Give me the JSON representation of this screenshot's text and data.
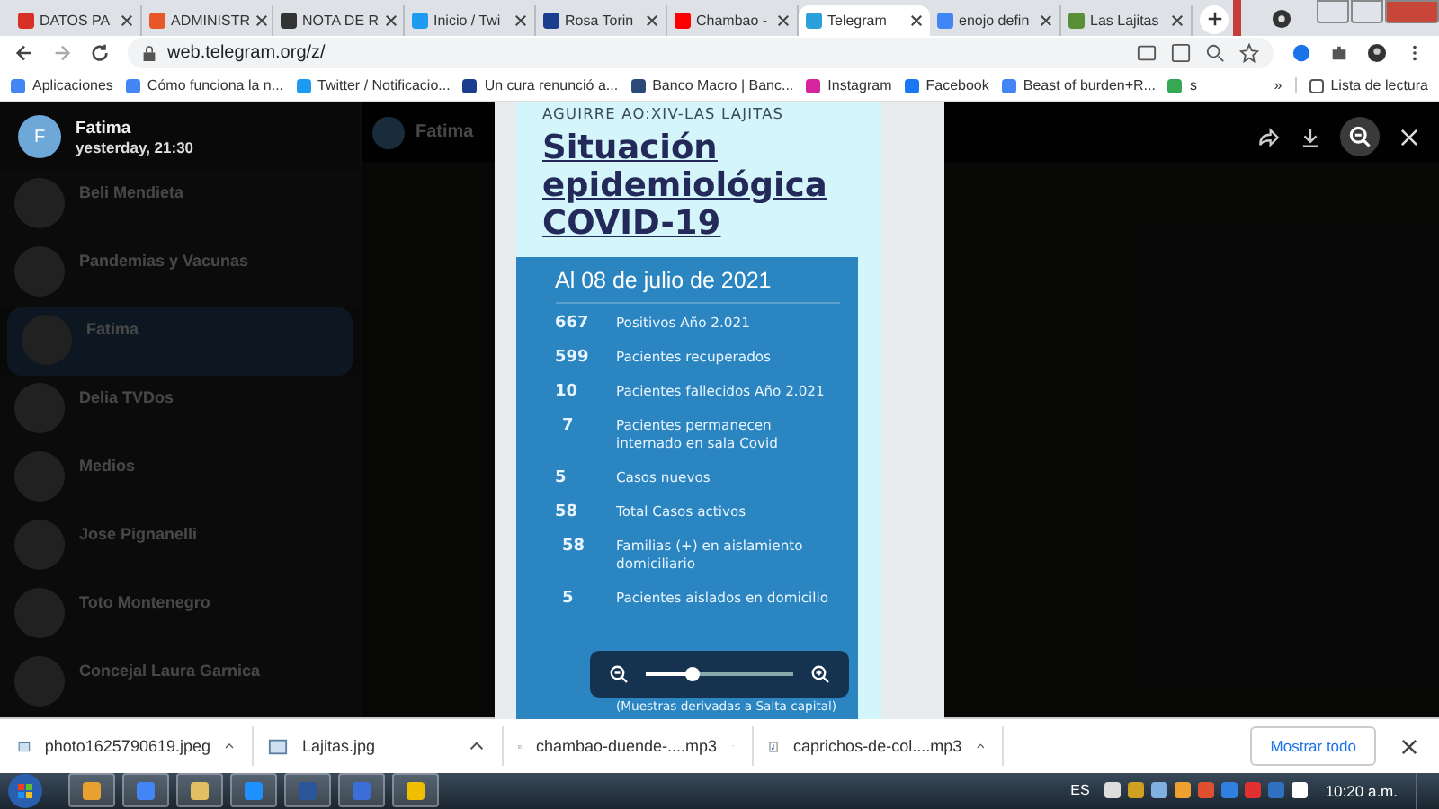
{
  "browser": {
    "tabs": [
      {
        "title": "DATOS PA",
        "selected": false,
        "color": "#d93025"
      },
      {
        "title": "ADMINISTR",
        "selected": false,
        "color": "#e8572a"
      },
      {
        "title": "NOTA DE R",
        "selected": false,
        "color": "#333333"
      },
      {
        "title": "Inicio / Twi",
        "selected": false,
        "color": "#1d9bf0"
      },
      {
        "title": "Rosa Torin",
        "selected": false,
        "color": "#1a3d8f"
      },
      {
        "title": "Chambao -",
        "selected": false,
        "color": "#ff0000"
      },
      {
        "title": "Telegram",
        "selected": true,
        "color": "#2aa1da"
      },
      {
        "title": "enojo defin",
        "selected": false,
        "color": "#4285f4"
      },
      {
        "title": "Las Lajitas",
        "selected": false,
        "color": "#5a8f3a"
      }
    ],
    "address": "web.telegram.org/z/",
    "bookmarks": [
      {
        "label": "Aplicaciones",
        "color": "#4285f4"
      },
      {
        "label": "Cómo funciona la n...",
        "color": "#4285f4"
      },
      {
        "label": "Twitter / Notificacio...",
        "color": "#1d9bf0"
      },
      {
        "label": "Un cura renunció a...",
        "color": "#1a3d8f"
      },
      {
        "label": "Banco Macro | Banc...",
        "color": "#2b4a7a"
      },
      {
        "label": "Instagram",
        "color": "#d6249f"
      },
      {
        "label": "Facebook",
        "color": "#1877f2"
      },
      {
        "label": "Beast of burden+R...",
        "color": "#4285f4"
      },
      {
        "label": "s",
        "color": "#34a853"
      }
    ],
    "more": "»",
    "reading_list": "Lista de lectura"
  },
  "telegram": {
    "chats": [
      {
        "name": "Beli Mendieta",
        "selected": false
      },
      {
        "name": "Pandemias y Vacunas",
        "selected": false
      },
      {
        "name": "Fatima",
        "selected": true
      },
      {
        "name": "Delia TVDos",
        "selected": false
      },
      {
        "name": "Medios",
        "selected": false
      },
      {
        "name": "Jose Pignanelli",
        "selected": false
      },
      {
        "name": "Toto Montenegro",
        "selected": false
      },
      {
        "name": "Concejal Laura Garnica",
        "selected": false
      }
    ],
    "chat_header": "Fatima"
  },
  "viewer": {
    "sender": {
      "initial": "F",
      "name": "Fatima",
      "time": "yesterday, 21:30"
    },
    "zoom": {
      "level": 0.32
    },
    "poster": {
      "header": "AGUIRRE AO:XIV-LAS LAJITAS",
      "title": [
        "Situación",
        "epidemiológica",
        "COVID-19"
      ],
      "date": "Al 08 de julio de 2021",
      "rows": [
        {
          "number": "667",
          "label": [
            "Positivos Año 2.021"
          ]
        },
        {
          "number": "599",
          "label": [
            "Pacientes recuperados"
          ]
        },
        {
          "number": "10",
          "label": [
            "Pacientes fallecidos Año 2.021"
          ]
        },
        {
          "number": "7",
          "label": [
            "Pacientes permanecen",
            "internado en sala Covid"
          ]
        },
        {
          "number": "5",
          "label": [
            "Casos nuevos"
          ]
        },
        {
          "number": "58",
          "label": [
            "Total Casos activos"
          ]
        },
        {
          "number": "58",
          "label": [
            "Familias (+) en aislamiento",
            "domiciliario"
          ]
        },
        {
          "number": "5",
          "label": [
            "Pacientes aislados en domicilio"
          ],
          "tail": "(Muestras derivadas a Salta capital)"
        }
      ]
    }
  },
  "downloads": {
    "files": [
      {
        "name": "photo1625790619.jpeg",
        "kind": "image"
      },
      {
        "name": "Lajitas.jpg",
        "kind": "image"
      },
      {
        "name": "chambao-duende-....mp3",
        "kind": "audio"
      },
      {
        "name": "caprichos-de-col....mp3",
        "kind": "audio"
      }
    ],
    "show_all": "Mostrar todo"
  },
  "taskbar": {
    "language": "ES",
    "clock": "10:20 a.m."
  }
}
